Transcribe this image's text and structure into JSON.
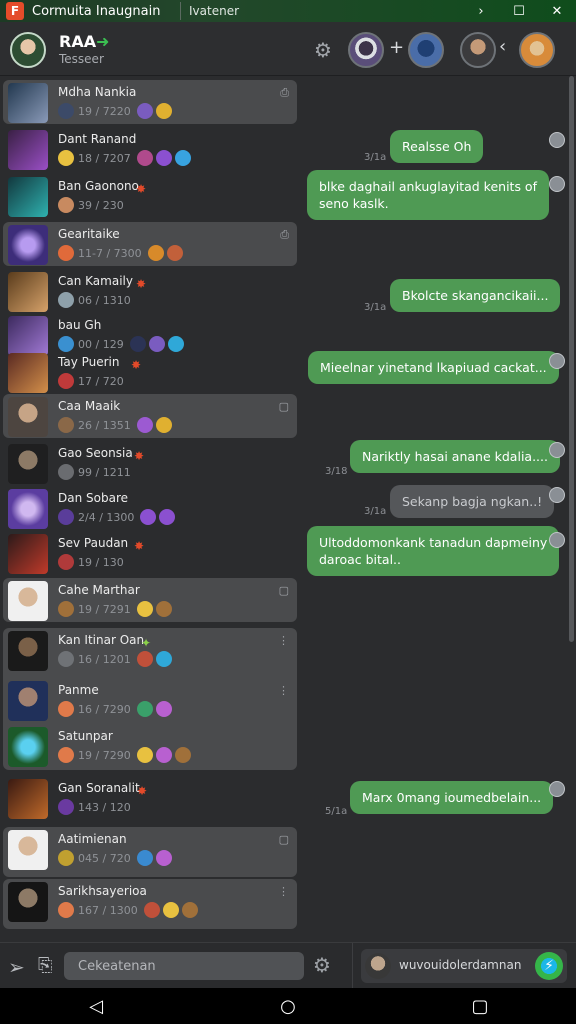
{
  "titlebar": {
    "logo": "F",
    "app_title": "Cormuita Inaugnain",
    "subtitle": "Ivatener",
    "controls": [
      "›",
      "☐",
      "✕"
    ]
  },
  "header": {
    "name": "RAA",
    "status": "Tesseer",
    "icons": {
      "settings": "gear-icon",
      "add": "+",
      "back": "‹"
    }
  },
  "chats": [
    {
      "name": "Mdha Nankia",
      "time": "19 / 7220",
      "corner": "⎙"
    },
    {
      "name": "Dant Ranand",
      "time": "18 / 7207",
      "corner": ""
    },
    {
      "name": "Ban Gaonono",
      "time": "39 / 230",
      "corner": ""
    },
    {
      "name": "Gearitaike",
      "time": "11-7 / 7300",
      "corner": "⎙"
    },
    {
      "name": "Can Kamaily",
      "time": "06 / 1310",
      "corner": ""
    },
    {
      "name": "bau Gh",
      "time": "00 / 129",
      "corner": ""
    },
    {
      "name": "Tay Puerin",
      "time": "17 / 720",
      "corner": ""
    },
    {
      "name": "Caa Maaik",
      "time": "26 / 1351",
      "corner": "▢"
    },
    {
      "name": "Gao Seonsia",
      "time": "99 / 1211",
      "corner": ""
    },
    {
      "name": "Dan Sobare",
      "time": "2/4 / 1300",
      "corner": ""
    },
    {
      "name": "Sev Paudan",
      "time": "19 / 130",
      "corner": ""
    },
    {
      "name": "Cahe Marthar",
      "time": "19 / 7291",
      "corner": "▢"
    },
    {
      "name": "Kan Itinar Oan",
      "time": "16 / 1201",
      "corner": "⋮"
    },
    {
      "name": "Panme",
      "time": "16 / 7290",
      "corner": "⋮"
    },
    {
      "name": "Satunpar",
      "time": "19 / 7290",
      "corner": ""
    },
    {
      "name": "Gan Soranalit",
      "time": "143 / 120",
      "corner": ""
    },
    {
      "name": "Aatimienan",
      "time": "045 / 720",
      "corner": "▢"
    },
    {
      "name": "Sarikhsayerioa",
      "time": "167 / 1300",
      "corner": "⋮"
    }
  ],
  "messages": [
    {
      "text": "Realsse Oh",
      "time": "3/1a"
    },
    {
      "text": "blke daghail ankuglayitad kenits of",
      "text2": "seno kaslk.",
      "time": ""
    },
    {
      "text": "Bkolcte skangancikaii...",
      "time": "3/1a"
    },
    {
      "text": "Mieelnar yinetand lkapiuad cackat...",
      "time": ""
    },
    {
      "text": "Nariktly hasai anane kdalia....",
      "time": "3/18"
    },
    {
      "text": "Sekanp bagja ngkan..!",
      "time": "3/1a"
    },
    {
      "text": "Ultoddomonkank tanadun dapmeiny",
      "text2": "daroac bital..",
      "time": ""
    },
    {
      "text": "Marx 0mang ioumedbelain...",
      "time": "5/1a"
    }
  ],
  "composer": {
    "placeholder": "Cekeatenan",
    "contact_name": "wuvouidolerdamnan"
  },
  "navbar": {
    "back": "◁",
    "home": "○",
    "recents": "▢"
  },
  "colors": {
    "accent": "#4f9a54",
    "titlebar": "#1d3a24",
    "background": "#2b2c2e",
    "flame": "#e24a2a"
  }
}
